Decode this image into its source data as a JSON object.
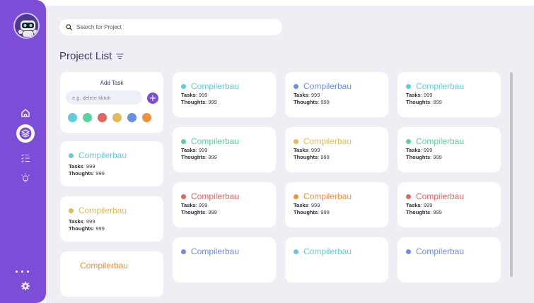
{
  "sidebar": {
    "avatar": "robot-avatar",
    "nav": [
      {
        "icon": "home-icon"
      },
      {
        "icon": "layers-icon",
        "active": true
      },
      {
        "icon": "checklist-icon"
      },
      {
        "icon": "lightbulb-icon"
      }
    ],
    "more": "more-dots-icon",
    "settings": "gear-icon"
  },
  "search": {
    "placeholder": "Search for Project"
  },
  "page_title": "Project List",
  "add_task": {
    "title": "Add Task",
    "placeholder": "e.g. delete tiktok",
    "add_button": "+",
    "swatches": [
      "#5fcde0",
      "#58d39a",
      "#e06464",
      "#e2bb58",
      "#6b8fe0",
      "#f08f3d"
    ]
  },
  "stat_labels": {
    "tasks": "Tasks",
    "thoughts": "Thoughts"
  },
  "projects": [
    {
      "name": "Compilerbau",
      "color": "#5fcde0",
      "tasks": "999",
      "thoughts": "999"
    },
    {
      "name": "Compilerbau",
      "color": "#e2bb58",
      "tasks": "999",
      "thoughts": "999"
    },
    {
      "name": "Compilerbau",
      "color": "#f08f3d",
      "tasks": "",
      "thoughts": ""
    },
    {
      "name": "Compilerbau",
      "color": "#58d39a",
      "tasks": "999",
      "thoughts": "999"
    },
    {
      "name": "Compilerbau",
      "color": "#e06464",
      "tasks": "999",
      "thoughts": "999"
    },
    {
      "name": "Compilerbau",
      "color": "#6b8fe0",
      "tasks": "",
      "thoughts": ""
    },
    {
      "name": "Compilerbau",
      "color": "#6b8fe0",
      "tasks": "999",
      "thoughts": "999"
    },
    {
      "name": "Compilerbau",
      "color": "#e2bb58",
      "tasks": "999",
      "thoughts": "999"
    },
    {
      "name": "Compilerbau",
      "color": "#f08f3d",
      "tasks": "999",
      "thoughts": "999"
    },
    {
      "name": "Compilerbau",
      "color": "#5fcde0",
      "tasks": "",
      "thoughts": ""
    },
    {
      "name": "Compilerbau",
      "color": "#5fcde0",
      "tasks": "999",
      "thoughts": "999"
    },
    {
      "name": "Compilerbau",
      "color": "#58d39a",
      "tasks": "999",
      "thoughts": "999"
    },
    {
      "name": "Compilerbau",
      "color": "#e06464",
      "tasks": "999",
      "thoughts": "999"
    },
    {
      "name": "Compilerbau",
      "color": "#6b8fe0",
      "tasks": "",
      "thoughts": ""
    }
  ]
}
